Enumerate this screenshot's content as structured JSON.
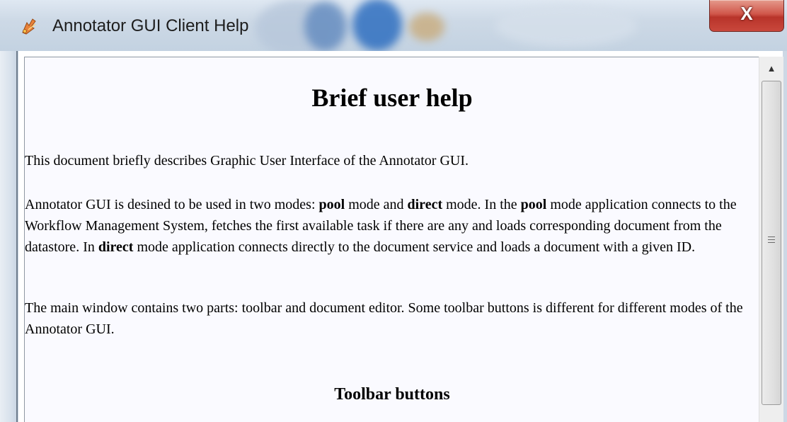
{
  "window": {
    "title": "Annotator GUI Client Help",
    "icon": "annotator-app-icon",
    "close_glyph": "X"
  },
  "document": {
    "heading": "Brief user help",
    "p1": "This document briefly describes Graphic User Interface of the Annotator GUI.",
    "p2": {
      "t1": "Annotator GUI is desined to be used in two modes: ",
      "b1": "pool",
      "t2": " mode and ",
      "b2": "direct",
      "t3": " mode. In the ",
      "b3": "pool",
      "t4": " mode application connects to the Workflow Management System, fetches the first available task if there are any and loads corresponding document from the datastore. In ",
      "b4": "direct",
      "t5": " mode application connects directly to the document service and loads a document with a given ID."
    },
    "p3": "The main window contains two parts: toolbar and document editor. Some toolbar buttons is different for different modes of the Annotator GUI.",
    "subheading": "Toolbar buttons"
  },
  "scrollbar": {
    "up_arrow": "▲",
    "up_icon": "scroll-up-arrow-icon",
    "grip_icon": "scroll-thumb-grip-icon"
  },
  "colors": {
    "close_button": "#c9473c",
    "content_background": "#fafaff"
  }
}
